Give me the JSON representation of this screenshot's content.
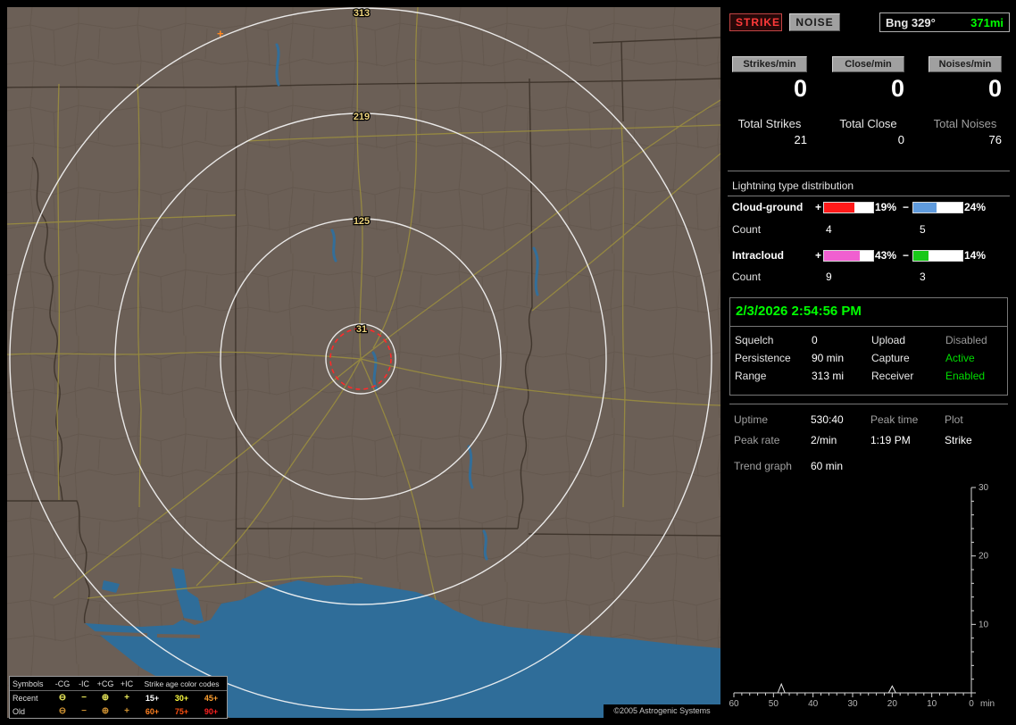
{
  "colors": {
    "active_green": "#00dd00",
    "datetime_green": "#00ff00",
    "strike_red": "#ff3a3a",
    "map_background": "#6b5f56",
    "water_blue": "#2f6d99",
    "road_yellow": "#9a8d3f",
    "range_ring_white": "#f5f5f5",
    "alarm_ring_red": "#ff2a2a"
  },
  "header": {
    "strike_btn": "STRIKE",
    "noise_btn": "NOISE",
    "bearing": "Bng 329°",
    "distance": "371mi"
  },
  "counters": [
    {
      "label": "Strikes/min",
      "value": "0",
      "total_label": "Total Strikes",
      "total": "21",
      "total_color": "#e6e6e6"
    },
    {
      "label": "Close/min",
      "value": "0",
      "total_label": "Total Close",
      "total": "0",
      "total_color": "#e6e6e6"
    },
    {
      "label": "Noises/min",
      "value": "0",
      "total_label": "Total Noises",
      "total": "76",
      "total_color": "#9f9f9f"
    }
  ],
  "distribution": {
    "title": "Lightning type distribution",
    "count_label": "Count",
    "rows": [
      {
        "name": "Cloud-ground",
        "plus_sign": "+",
        "minus_sign": "−",
        "plus_pct": "19%",
        "minus_pct": "24%",
        "plus_count": "4",
        "minus_count": "5",
        "plus_color": "#ff1a1a",
        "minus_color": "#5f9bdd",
        "plus_fill": 62,
        "minus_fill": 48
      },
      {
        "name": "Intracloud",
        "plus_sign": "+",
        "minus_sign": "−",
        "plus_pct": "43%",
        "minus_pct": "14%",
        "plus_count": "9",
        "minus_count": "3",
        "plus_color": "#f05fd0",
        "minus_color": "#18c818",
        "plus_fill": 73,
        "minus_fill": 30
      }
    ]
  },
  "status": {
    "datetime": "2/3/2026 2:54:56 PM",
    "rows": [
      {
        "l1": "Squelch",
        "v1": "0",
        "l2": "Upload",
        "v2": "Disabled",
        "v2_color": "#9a9a9a"
      },
      {
        "l1": "Persistence",
        "v1": "90 min",
        "l2": "Capture",
        "v2": "Active",
        "v2_color": "#00dd00"
      },
      {
        "l1": "Range",
        "v1": "313 mi",
        "l2": "Receiver",
        "v2": "Enabled",
        "v2_color": "#00dd00"
      }
    ]
  },
  "stats2": {
    "rows": [
      {
        "c1": "Uptime",
        "c2": "530:40",
        "c3": "Peak time",
        "c4": "Plot"
      },
      {
        "c1": "Peak rate",
        "c2": "2/min",
        "c3": "1:19 PM",
        "c4": "Strike"
      }
    ],
    "trend_label": "Trend graph",
    "trend_value": "60 min"
  },
  "chart_data": {
    "type": "line",
    "title": "Trend graph 60 min",
    "xlabel": "min",
    "x_ticks": [
      60,
      50,
      40,
      30,
      20,
      10,
      0
    ],
    "y_ticks": [
      10,
      20,
      30
    ],
    "xlim": [
      60,
      0
    ],
    "ylim": [
      0,
      30
    ],
    "legend_position": "none",
    "series": [
      {
        "name": "strikes-per-min",
        "points": [
          [
            48,
            1.3
          ],
          [
            20,
            1.0
          ]
        ]
      }
    ]
  },
  "map": {
    "range_labels": [
      "313",
      "219",
      "125",
      "31"
    ],
    "strike_marker": "+",
    "copyright": "©2005 Astrogenic Systems"
  },
  "legend": {
    "header": {
      "symbols": "Symbols",
      "cols": [
        "-CG",
        "-IC",
        "+CG",
        "+IC"
      ],
      "ages": "Strike age color codes"
    },
    "rows": [
      {
        "label": "Recent",
        "symbols": [
          "⊖",
          "−",
          "⊕",
          "+"
        ],
        "symbol_color": "#e8e85a",
        "ages": [
          {
            "t": "15+",
            "c": "#ffffff"
          },
          {
            "t": "30+",
            "c": "#ffff40"
          },
          {
            "t": "45+",
            "c": "#ffa030"
          }
        ]
      },
      {
        "label": "Old",
        "symbols": [
          "⊖",
          "−",
          "⊕",
          "+"
        ],
        "symbol_color": "#cf9232",
        "ages": [
          {
            "t": "60+",
            "c": "#ff8020"
          },
          {
            "t": "75+",
            "c": "#ff5010"
          },
          {
            "t": "90+",
            "c": "#ff2020"
          }
        ]
      }
    ]
  }
}
